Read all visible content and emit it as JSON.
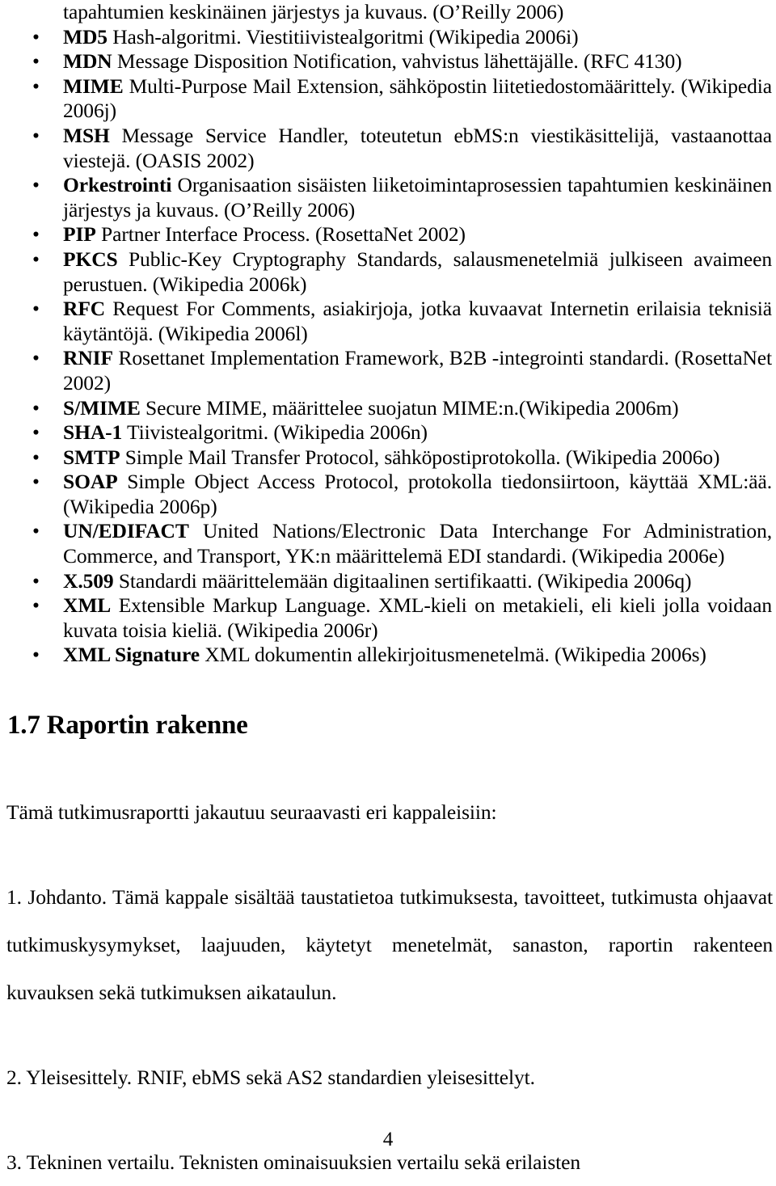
{
  "document": {
    "page_number": "4",
    "bullet_glyph": "•"
  },
  "glossary": {
    "continuation_from_previous_entry": "tapahtumien keskinäinen järjestys ja kuvaus. (O’Reilly 2006)",
    "entries": [
      {
        "term": "MD5",
        "definition": " Hash-algoritmi. Viestitiivistealgoritmi (Wikipedia 2006i)"
      },
      {
        "term": "MDN",
        "definition": " Message Disposition Notification, vahvistus lähettäjälle. (RFC 4130)"
      },
      {
        "term": "MIME",
        "definition": " Multi-Purpose Mail Extension, sähköpostin liitetiedostomäärittely. (Wikipedia 2006j)"
      },
      {
        "term": "MSH",
        "definition": " Message Service Handler, toteutetun ebMS:n viestikäsittelijä, vastaanottaa viestejä. (OASIS 2002)"
      },
      {
        "term": "Orkestrointi",
        "definition": " Organisaation sisäisten liiketoimintaprosessien tapahtumien keskinäinen järjestys ja kuvaus. (O’Reilly 2006)"
      },
      {
        "term": "PIP",
        "definition": "  Partner Interface Process. (RosettaNet 2002)"
      },
      {
        "term": "PKCS",
        "definition": " Public-Key Cryptography Standards, salausmenetelmiä julkiseen avaimeen perustuen. (Wikipedia 2006k)"
      },
      {
        "term": "RFC",
        "definition": " Request For Comments, asiakirjoja, jotka kuvaavat Internetin erilaisia teknisiä käytäntöjä. (Wikipedia 2006l)"
      },
      {
        "term": "RNIF",
        "definition": " Rosettanet Implementation Framework, B2B -integrointi standardi. (RosettaNet 2002)"
      },
      {
        "term": "S/MIME",
        "definition": " Secure MIME, määrittelee suojatun MIME:n.(Wikipedia 2006m)"
      },
      {
        "term": "SHA-1",
        "definition": " Tiivistealgoritmi. (Wikipedia 2006n)"
      },
      {
        "term": "SMTP",
        "definition": " Simple Mail Transfer Protocol, sähköpostiprotokolla. (Wikipedia 2006o)"
      },
      {
        "term": "SOAP",
        "definition": " Simple Object Access Protocol, protokolla tiedonsiirtoon, käyttää XML:ää. (Wikipedia 2006p)"
      },
      {
        "term": "UN/EDIFACT",
        "definition": " United Nations/Electronic Data Interchange For Administration, Commerce, and Transport, YK:n määrittelemä EDI standardi. (Wikipedia 2006e)"
      },
      {
        "term": "X.509",
        "definition": " Standardi määrittelemään digitaalinen sertifikaatti. (Wikipedia 2006q)"
      },
      {
        "term": "XML",
        "definition": " Extensible Markup Language. XML-kieli on metakieli, eli kieli jolla voidaan kuvata toisia kieliä. (Wikipedia 2006r)"
      },
      {
        "term": "XML Signature",
        "definition": " XML dokumentin allekirjoitusmenetelmä. (Wikipedia 2006s)"
      }
    ]
  },
  "section": {
    "heading": "1.7 Raportin rakenne",
    "intro": "Tämä tutkimusraportti jakautuu seuraavasti eri kappaleisiin:",
    "chapters": [
      "1. Johdanto. Tämä kappale sisältää taustatietoa tutkimuksesta, tavoitteet, tutkimusta ohjaavat tutkimuskysymykset, laajuuden, käytetyt menetelmät, sanaston, raportin rakenteen kuvauksen sekä tutkimuksen aikataulun.",
      "2. Yleisesittely. RNIF, ebMS sekä AS2 standardien yleisesittelyt.",
      "3. Tekninen vertailu. Teknisten ominaisuuksien vertailu sekä erilaisten"
    ]
  }
}
